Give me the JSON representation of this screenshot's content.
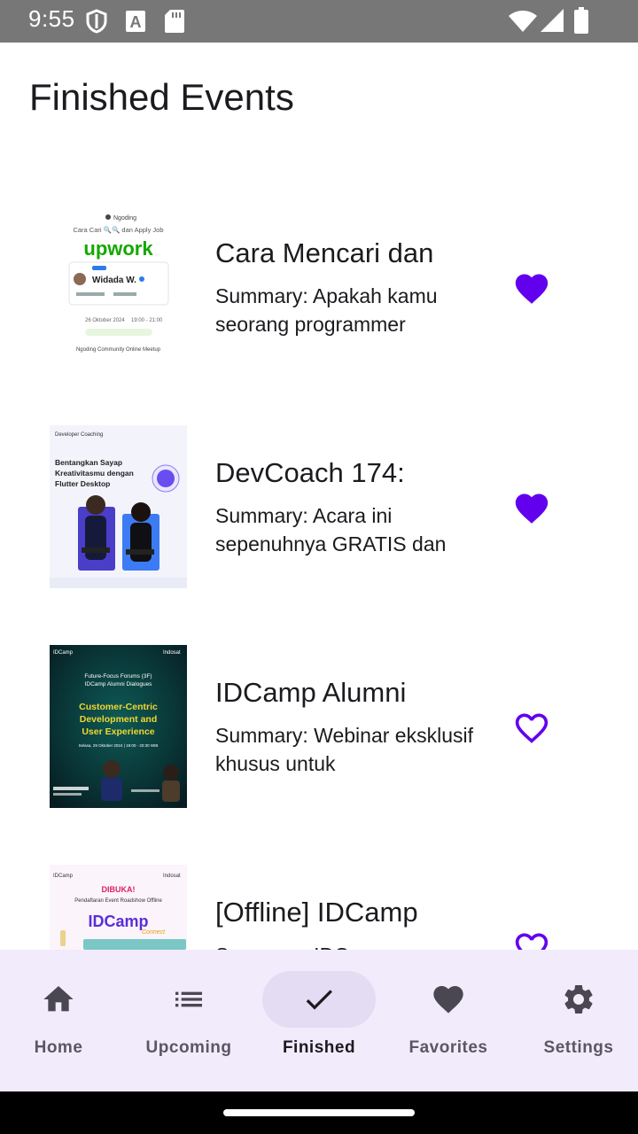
{
  "status_bar": {
    "time": "9:55"
  },
  "page": {
    "title": "Finished Events"
  },
  "events": [
    {
      "title": "Cara Mencari dan",
      "summary": "Summary: Apakah kamu seorang programmer",
      "favorite": true,
      "thumb": {
        "header": "Cara Cari 🔍🔍 dan Apply Job",
        "brand": "upwork",
        "name": "Widada W.",
        "footer": "Ngoding Community Online Meetup",
        "date": "26 Oktober 2024",
        "time": "19:00 - 21:00"
      }
    },
    {
      "title": "DevCoach 174:",
      "summary": "Summary: Acara ini sepenuhnya GRATIS dan",
      "favorite": true,
      "thumb": {
        "header": "Developer Coaching",
        "headline": "Bentangkan Sayap Kreativitasmu dengan Flutter Desktop"
      }
    },
    {
      "title": "IDCamp Alumni",
      "summary": "Summary: Webinar eksklusif khusus untuk",
      "favorite": false,
      "thumb": {
        "sub": "Future-Focus Forums (3F) IDCamp Alumni Dialogues",
        "headline": "Customer-Centric Development and User Experience",
        "date": "Selasa, 29 Oktober 2024 | 19:00 - 20:30 WIB"
      }
    },
    {
      "title": "[Offline] IDCamp",
      "summary": "Summary: IDCamp",
      "favorite": false,
      "thumb": {
        "badge": "DIBUKA!",
        "sub": "Pendaftaran Event Roadshow Offline",
        "brand": "IDCamp",
        "tag": "Connect"
      }
    }
  ],
  "bottom_nav": {
    "items": [
      {
        "label": "Home",
        "icon": "home-icon",
        "active": false
      },
      {
        "label": "Upcoming",
        "icon": "list-icon",
        "active": false
      },
      {
        "label": "Finished",
        "icon": "check-icon",
        "active": true
      },
      {
        "label": "Favorites",
        "icon": "heart-icon",
        "active": false
      },
      {
        "label": "Settings",
        "icon": "gear-icon",
        "active": false
      }
    ]
  },
  "colors": {
    "accent": "#6200EE",
    "nav_bg": "#F2EBFB",
    "nav_active_pill": "#E4DCF2",
    "status_bar": "#777777"
  }
}
